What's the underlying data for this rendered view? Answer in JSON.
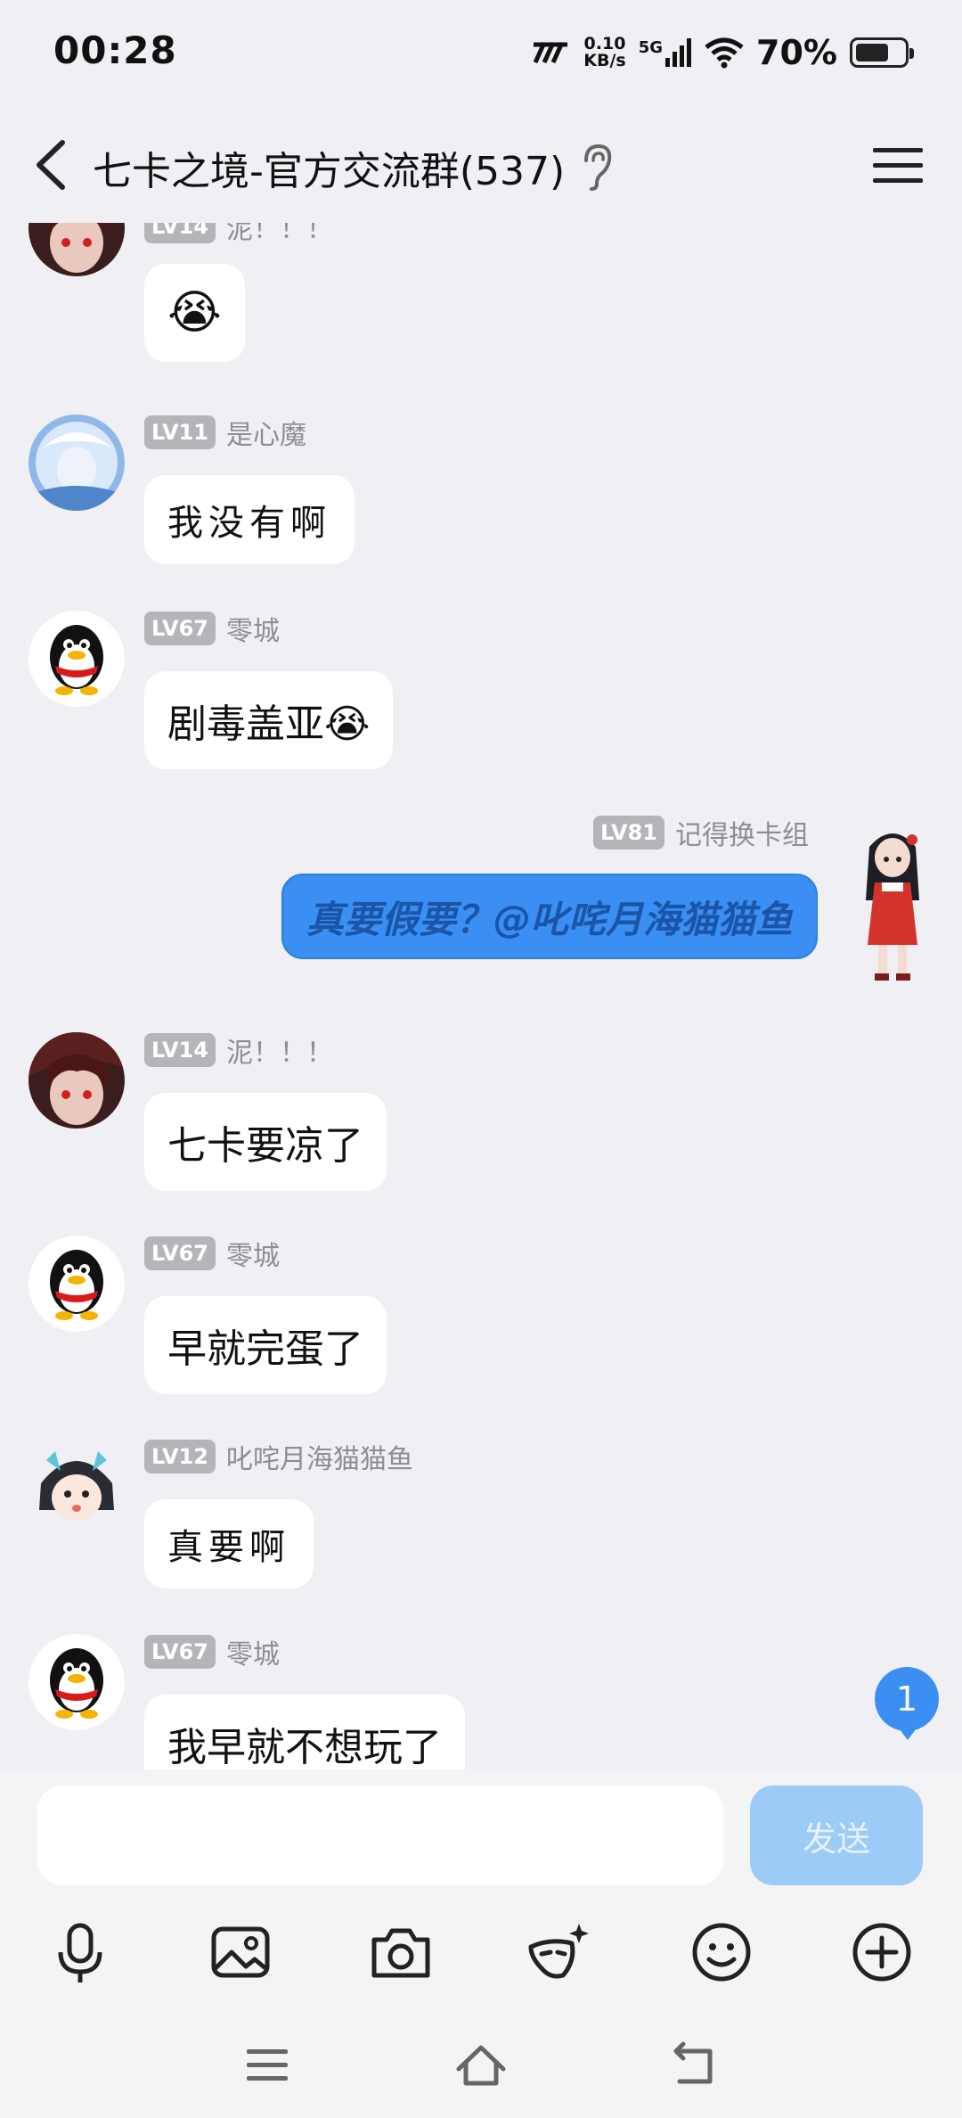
{
  "status_bar": {
    "time": "00:28",
    "net_speed_value": "0.10",
    "net_speed_unit": "KB/s",
    "network_type": "5G",
    "battery": "70%",
    "battery_level": 0.7
  },
  "header": {
    "title": "七卡之境-官方交流群(537)"
  },
  "messages": [
    {
      "level": "LV14",
      "nickname": "泥！！！",
      "text": "😭"
    },
    {
      "level": "LV11",
      "nickname": "是心魔",
      "text": "我没有啊"
    },
    {
      "level": "LV67",
      "nickname": "零城",
      "text": "剧毒盖亚😭"
    },
    {
      "level": "LV81",
      "nickname": "记得换卡组",
      "text": "真要假要？@叱咤月海猫猫鱼"
    },
    {
      "level": "LV14",
      "nickname": "泥！！！",
      "text": "七卡要凉了"
    },
    {
      "level": "LV67",
      "nickname": "零城",
      "text": "早就完蛋了"
    },
    {
      "level": "LV12",
      "nickname": "叱咤月海猫猫鱼",
      "text": "真要啊"
    },
    {
      "level": "LV67",
      "nickname": "零城",
      "text": "我早就不想玩了"
    }
  ],
  "unread_count": "1",
  "input": {
    "send_label": "发送"
  },
  "colors": {
    "accent": "#3b8ef2",
    "background": "#f0f0f4",
    "send_disabled": "#9ccbf7"
  }
}
